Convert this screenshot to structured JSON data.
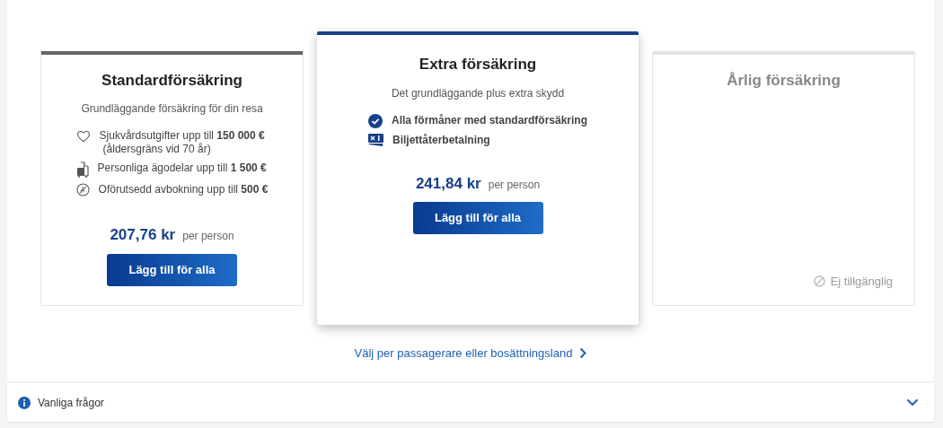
{
  "plans": [
    {
      "title": "Standardförsäkring",
      "subtitle": "Grundläggande försäkring för din resa",
      "selected": false,
      "available": true,
      "features": [
        {
          "kind": "heart",
          "text": "Sjukvårdsutgifter upp till **150 000 €**",
          "note": "(åldersgräns vid 70 år)"
        },
        {
          "kind": "luggage",
          "text": "Personliga ägodelar upp till **1 500 €**"
        },
        {
          "kind": "cancel",
          "text": "Oförutsedd avbokning upp till **500 €**"
        }
      ],
      "price": "207,76 kr",
      "price_unit": "per person",
      "button": "Lägg till för alla"
    },
    {
      "title": "Extra försäkring",
      "subtitle": "Det grundläggande plus extra skydd",
      "selected": true,
      "available": true,
      "features": [
        {
          "kind": "check",
          "text": "**Alla förmåner med standardförsäkring**"
        },
        {
          "kind": "ticket",
          "text": "**Biljettåterbetalning**"
        }
      ],
      "price": "241,84 kr",
      "price_unit": "per person",
      "button": "Lägg till för alla"
    },
    {
      "title": "Årlig försäkring",
      "selected": false,
      "available": false,
      "unavailable_label": "Ej tillgänglig"
    }
  ],
  "link": "Välj per passagerare eller bosättningsland",
  "faq": {
    "label": "Vanliga frågor",
    "expanded": false
  }
}
